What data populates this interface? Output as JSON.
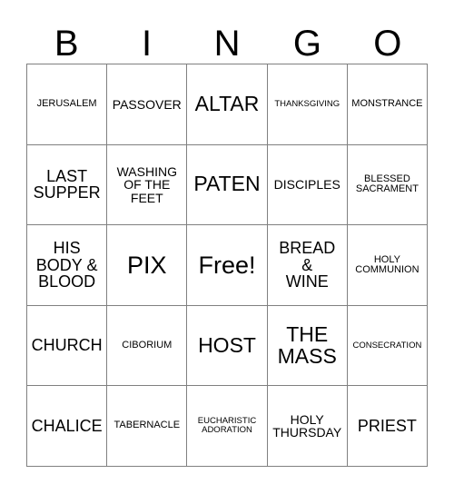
{
  "card": {
    "title_letters": [
      "B",
      "I",
      "N",
      "G",
      "O"
    ],
    "columns": 5,
    "rows": 5,
    "free_space": {
      "row": 3,
      "column": 3,
      "label": "Free!"
    },
    "border_color": "#808080",
    "text_color": "#000000",
    "background_color": "#ffffff",
    "grid": [
      [
        {
          "label": "JERUSALEM",
          "size": "xs"
        },
        {
          "label": "PASSOVER",
          "size": "sm"
        },
        {
          "label": "ALTAR",
          "size": "lg"
        },
        {
          "label": "THANKSGIVING",
          "size": "xxs"
        },
        {
          "label": "MONSTRANCE",
          "size": "xs"
        }
      ],
      [
        {
          "label": "LAST\nSUPPER",
          "size": "md"
        },
        {
          "label": "WASHING\nOF THE\nFEET",
          "size": "sm"
        },
        {
          "label": "PATEN",
          "size": "lg"
        },
        {
          "label": "DISCIPLES",
          "size": "sm"
        },
        {
          "label": "BLESSED\nSACRAMENT",
          "size": "xs"
        }
      ],
      [
        {
          "label": "HIS\nBODY &\nBLOOD",
          "size": "md"
        },
        {
          "label": "PIX",
          "size": "xl"
        },
        {
          "label": "Free!",
          "size": "xl"
        },
        {
          "label": "BREAD\n&\nWINE",
          "size": "md"
        },
        {
          "label": "HOLY\nCOMMUNION",
          "size": "xs"
        }
      ],
      [
        {
          "label": "CHURCH",
          "size": "md"
        },
        {
          "label": "CIBORIUM",
          "size": "xs"
        },
        {
          "label": "HOST",
          "size": "lg"
        },
        {
          "label": "THE\nMASS",
          "size": "lg"
        },
        {
          "label": "CONSECRATION",
          "size": "xxs"
        }
      ],
      [
        {
          "label": "CHALICE",
          "size": "md"
        },
        {
          "label": "TABERNACLE",
          "size": "xs"
        },
        {
          "label": "EUCHARISTIC\nADORATION",
          "size": "xxs"
        },
        {
          "label": "HOLY\nTHURSDAY",
          "size": "sm"
        },
        {
          "label": "PRIEST",
          "size": "md"
        }
      ]
    ]
  }
}
